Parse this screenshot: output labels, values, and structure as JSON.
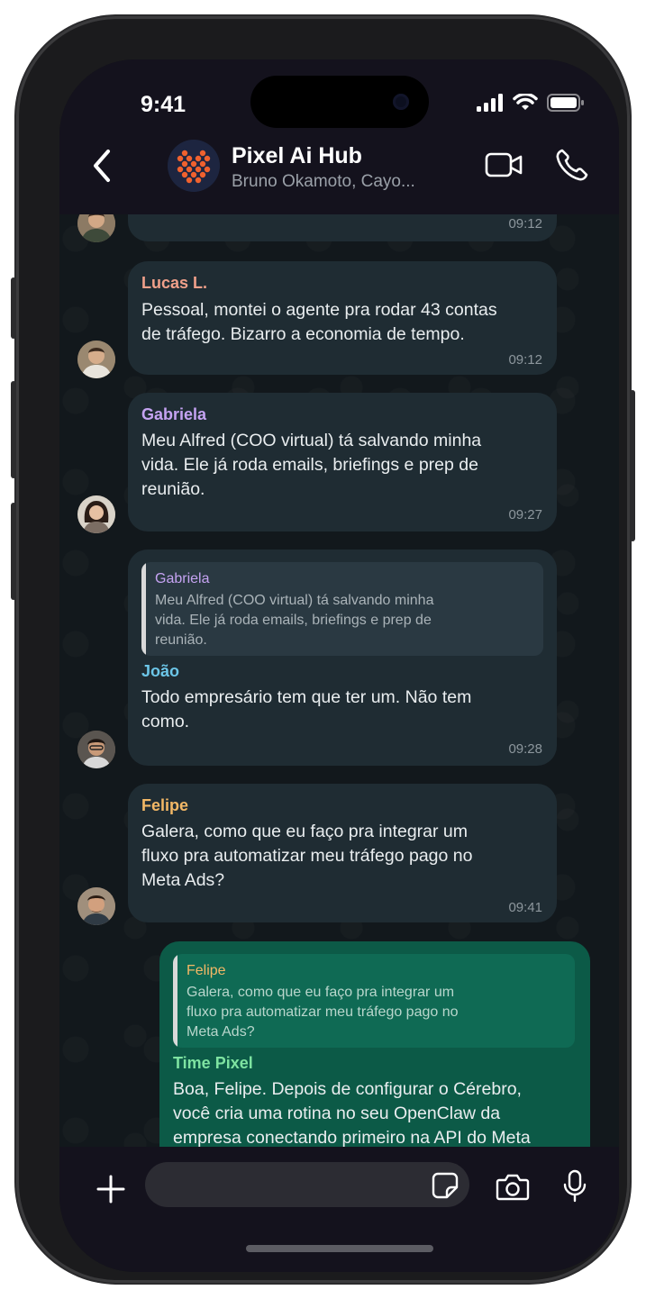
{
  "status_bar": {
    "time": "9:41"
  },
  "header": {
    "group_name": "Pixel Ai Hub",
    "members": "Bruno Okamoto, Cayo..."
  },
  "colors": {
    "lucas": "#f0a08a",
    "gabriela": "#c5a3f2",
    "joao": "#6cc6e8",
    "felipe": "#f3b866",
    "time_pixel": "#7ee3a1",
    "outgoing_bubble": "#0c5a47",
    "incoming_bubble": "#1f2c33"
  },
  "messages": [
    {
      "time": "09:12"
    },
    {
      "sender": "Lucas L.",
      "lines": [
        "Pessoal, montei o agente pra rodar 43 contas",
        "de tráfego. Bizarro a economia de tempo."
      ],
      "time": "09:12"
    },
    {
      "sender": "Gabriela",
      "lines": [
        "Meu Alfred (COO virtual) tá salvando minha",
        "vida. Ele já roda emails, briefings e prep de",
        "reunião."
      ],
      "time": "09:27"
    },
    {
      "quote": {
        "sender": "Gabriela",
        "lines": [
          "Meu Alfred (COO virtual) tá salvando minha",
          "vida. Ele já roda emails, briefings e prep de",
          "reunião."
        ]
      },
      "sender": "João",
      "lines": [
        "Todo empresário tem que ter um. Não tem",
        "como."
      ],
      "time": "09:28"
    },
    {
      "sender": "Felipe",
      "lines": [
        "Galera, como que eu faço pra integrar um",
        "fluxo pra automatizar meu tráfego pago no",
        "Meta Ads?"
      ],
      "time": "09:41"
    },
    {
      "quote": {
        "sender": "Felipe",
        "lines": [
          "Galera, como que eu faço pra integrar um",
          "fluxo pra automatizar meu tráfego pago no",
          "Meta Ads?"
        ]
      },
      "sender": "Time Pixel",
      "lines": [
        "Boa, Felipe. Depois de configurar o Cérebro,",
        "você cria uma rotina no seu OpenClaw da",
        "empresa conectando primeiro na API do Meta"
      ]
    }
  ],
  "composer": {
    "placeholder": ""
  },
  "icons": [
    "back-icon",
    "group-logo-icon",
    "video-call-icon",
    "phone-call-icon",
    "plus-icon",
    "sticker-icon",
    "camera-icon",
    "microphone-icon",
    "signal-icon",
    "wifi-icon",
    "battery-icon"
  ]
}
